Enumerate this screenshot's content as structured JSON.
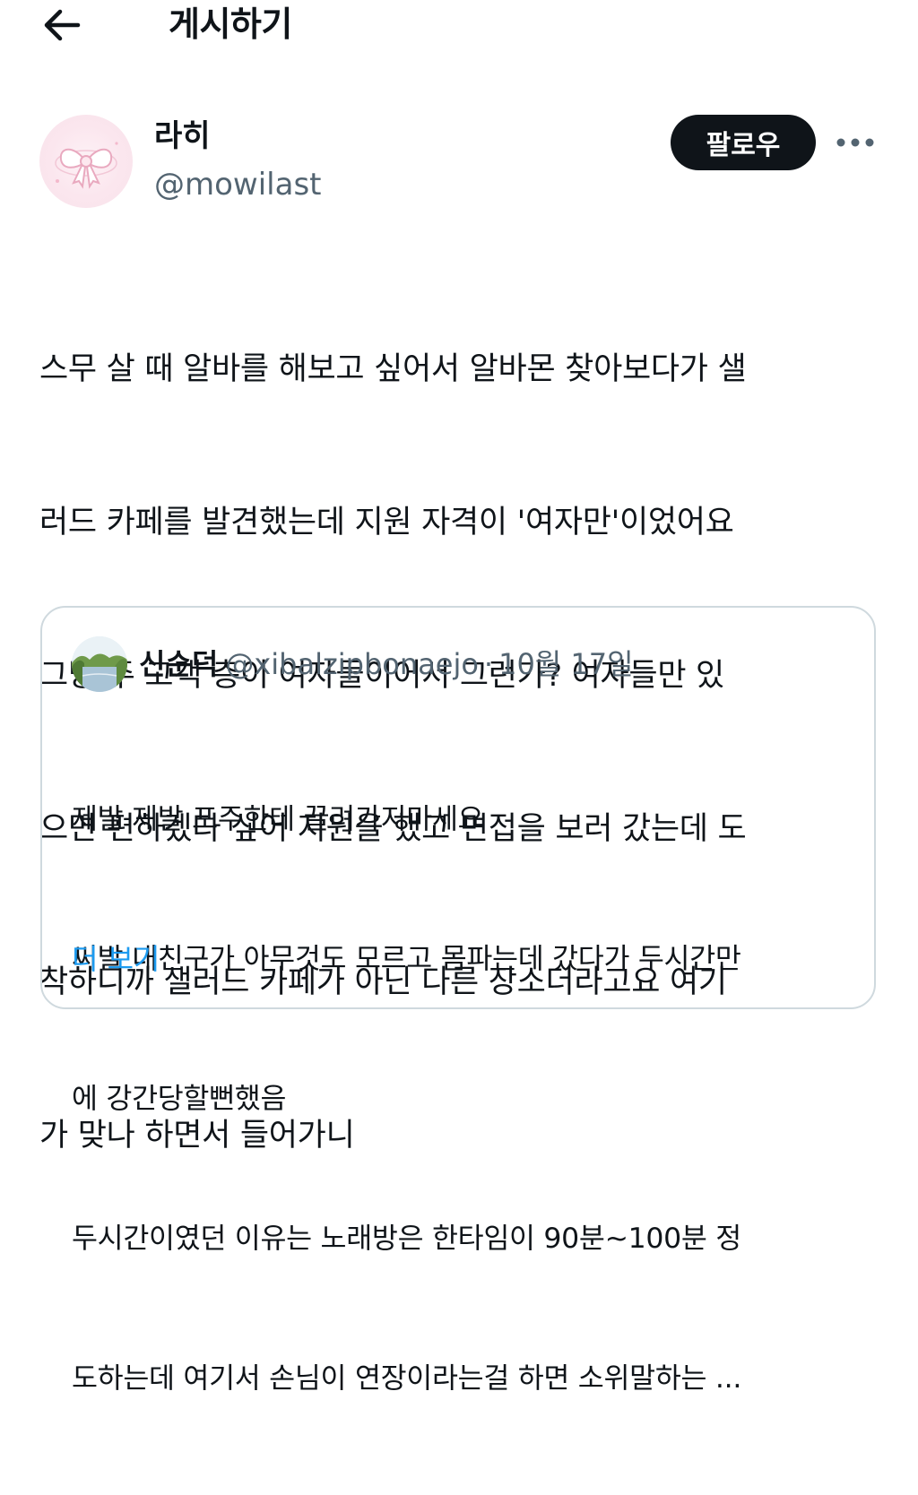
{
  "header": {
    "title": "게시하기",
    "back_icon": "arrow-left-icon"
  },
  "author": {
    "display_name": "라히",
    "handle": "@mowilast",
    "avatar_icon": "pink-ribbon-bow-icon"
  },
  "actions": {
    "follow_label": "팔로우",
    "more_icon": "more-horizontal-icon"
  },
  "post": {
    "lines": [
      "스무 살 때 알바를 해보고 싶어서 알바몬 찾아보다가 샐",
      "러드 카페를 발견했는데 지원 자격이 '여자만'이었어요",
      "그냥 주 고객 층이 여자들이어서 그런가? 여자들만 있",
      "으면 편하겠다 싶어 지원을 했고 면접을 보러 갔는데 도",
      "착하니까 샐러드 카페가 아닌 다른 장소더라고요 여기",
      "가 맞나 하면서 들어가니"
    ]
  },
  "quote": {
    "display_name": "신순덕",
    "handle": "@xibalzipbonaejo",
    "separator": "·",
    "date": "10월 17일",
    "avatar_icon": "landscape-photo-icon",
    "lines": [
      "제발 제발 포주한테 끌려가지마세요",
      "씨발 내친구가 아무것도 모르고 몸파는데 갔다가 두시간만",
      "에 강간당할뻔했음",
      "두시간이였던 이유는 노래방은 한타임이 90분~100분 정",
      "도하는데 여기서 손님이 연장이라는걸 하면 소위말하는 ..."
    ],
    "show_more_label": "더 보기"
  },
  "colors": {
    "text_primary": "#0f1419",
    "text_secondary": "#536471",
    "link": "#1d9bf0",
    "border": "#cfd9de",
    "follow_bg": "#0f1419"
  }
}
